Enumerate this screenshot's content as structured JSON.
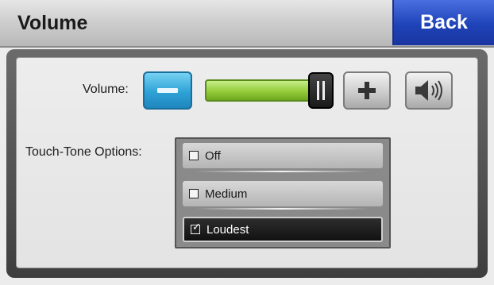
{
  "header": {
    "title": "Volume",
    "back_label": "Back"
  },
  "volume": {
    "label": "Volume:",
    "level": 1.0
  },
  "touch_tone": {
    "label": "Touch-Tone Options:",
    "options": [
      {
        "label": "Off",
        "checked": false
      },
      {
        "label": "Medium",
        "checked": false
      },
      {
        "label": "Loudest",
        "checked": true
      }
    ]
  },
  "icons": {
    "minus": "minus-icon",
    "plus": "plus-icon",
    "speaker": "speaker-icon",
    "slider": "slider-grip-icon",
    "check": "checkmark-icon"
  },
  "colors": {
    "accent": "#1f43b8",
    "slider_fill": "#94cc3a",
    "minus_button": "#2ea2d6"
  }
}
